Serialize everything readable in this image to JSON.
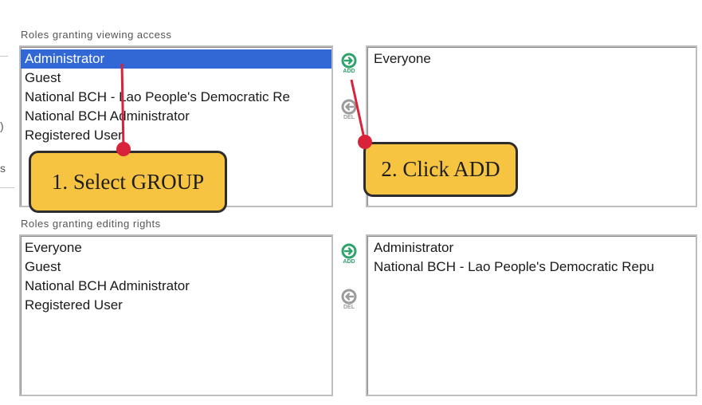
{
  "viewing": {
    "label": "Roles granting viewing access",
    "available": [
      "Administrator",
      "Guest",
      "National BCH - Lao People's Democratic Re",
      "National BCH Administrator",
      "Registered User"
    ],
    "selected_index": 0,
    "granted": [
      "Everyone"
    ]
  },
  "editing": {
    "label": "Roles granting editing rights",
    "available": [
      "Everyone",
      "Guest",
      "National BCH Administrator",
      "Registered User"
    ],
    "granted": [
      "Administrator",
      "National BCH - Lao People's Democratic Repu"
    ]
  },
  "buttons": {
    "add_label": "ADD",
    "del_label": "DEL"
  },
  "callouts": {
    "select_group": "1. Select GROUP",
    "click_add": "2. Click ADD"
  },
  "side_fragments": [
    ")",
    "s"
  ],
  "colors": {
    "selection": "#3168d5",
    "callout_fill": "#f7c442",
    "pointer": "#d9233a",
    "add_arrow": "#2fa36b",
    "del_arrow": "#9a9a9a"
  }
}
